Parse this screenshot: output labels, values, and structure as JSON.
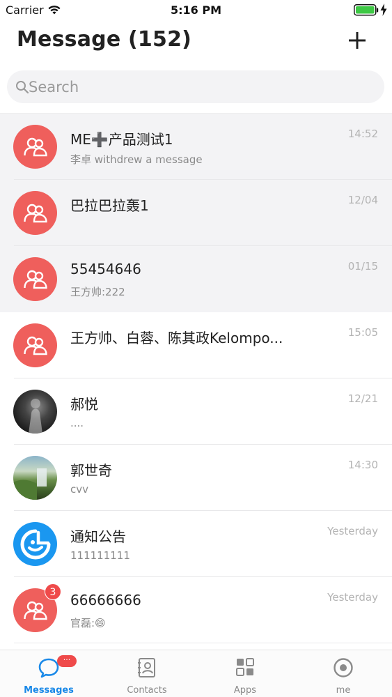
{
  "status_bar": {
    "carrier": "Carrier",
    "time": "5:16 PM"
  },
  "header": {
    "title": "Message (152)",
    "add_icon": "plus-icon"
  },
  "search": {
    "placeholder": "Search",
    "value": ""
  },
  "conversations": [
    {
      "title": "ME➕产品测试1",
      "preview": "李卓 withdrew a message",
      "time": "14:52",
      "avatar": "group-avatar",
      "pinned": true
    },
    {
      "title": "巴拉巴拉轰1",
      "preview": "",
      "time": "12/04",
      "avatar": "group-avatar",
      "pinned": true
    },
    {
      "title": "55454646",
      "preview": "王方帅:222",
      "time": "01/15",
      "avatar": "group-avatar",
      "pinned": true
    },
    {
      "title": "王方帅、白蓉、陈其政Kelompo...",
      "preview": "",
      "time": "15:05",
      "avatar": "group-avatar",
      "pinned": false
    },
    {
      "title": "郝悦",
      "preview": "....",
      "time": "12/21",
      "avatar": "user-photo-avatar",
      "pinned": false
    },
    {
      "title": "郭世奇",
      "preview": "cvv",
      "time": "14:30",
      "avatar": "landscape-photo-avatar",
      "pinned": false
    },
    {
      "title": "通知公告",
      "preview": "111111111",
      "time": "Yesterday",
      "avatar": "notice-avatar",
      "pinned": false
    },
    {
      "title": "66666666",
      "preview": "官磊:😄",
      "time": "Yesterday",
      "avatar": "group-avatar",
      "pinned": false,
      "unread": "3"
    }
  ],
  "tab_bar": {
    "tabs": [
      {
        "label": "Messages",
        "icon": "chat-bubble-icon",
        "active": true,
        "badge": "···"
      },
      {
        "label": "Contacts",
        "icon": "contacts-book-icon",
        "active": false
      },
      {
        "label": "Apps",
        "icon": "apps-grid-icon",
        "active": false
      },
      {
        "label": "me",
        "icon": "profile-circle-icon",
        "active": false
      }
    ]
  },
  "colors": {
    "accent": "#1a89e8",
    "group_avatar": "#ef5f5c",
    "notice_avatar": "#1a97f0",
    "badge": "#ef4a4a",
    "pinned_row": "#f3f3f5"
  }
}
